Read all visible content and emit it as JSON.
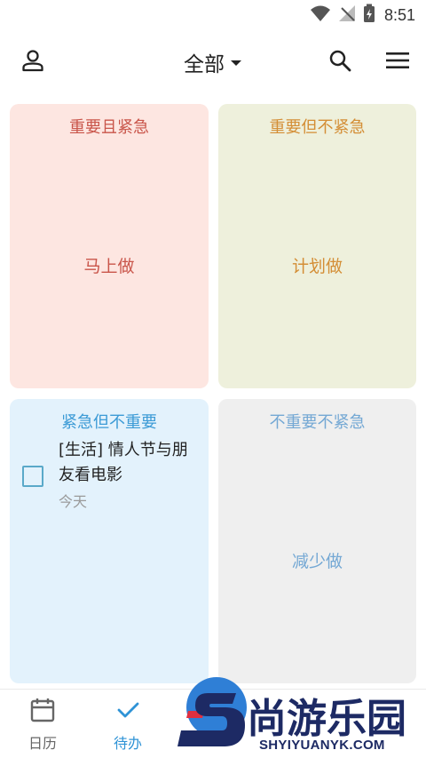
{
  "status_bar": {
    "time": "8:51",
    "icons": [
      "wifi-icon",
      "no-signal-icon",
      "battery-charging-icon"
    ]
  },
  "toolbar": {
    "filter_label": "全部",
    "icons": [
      "user-icon",
      "caret-down-icon",
      "search-icon",
      "menu-icon"
    ]
  },
  "quadrants": {
    "q1": {
      "title": "重要且紧急",
      "hint": "马上做",
      "color": "#c9554a",
      "background": "#fde6e1"
    },
    "q2": {
      "title": "重要但不紧急",
      "hint": "计划做",
      "color": "#d48e36",
      "background": "#eef0dc"
    },
    "q3": {
      "title": "紧急但不重要",
      "color": "#3c9bd6",
      "background": "#e3f2fc",
      "tasks": [
        {
          "title": "[生活] 情人节与朋友看电影",
          "date": "今天",
          "checked": false
        }
      ]
    },
    "q4": {
      "title": "不重要不紧急",
      "hint": "减少做",
      "color": "#74a8d4",
      "background": "#efefef"
    }
  },
  "bottom_nav": {
    "items": [
      {
        "label": "日历",
        "icon": "calendar-icon",
        "active": false
      },
      {
        "label": "待办",
        "icon": "check-icon",
        "active": true
      }
    ],
    "active_color": "#2f93d6"
  },
  "watermark": {
    "brand": "尚游乐园",
    "domain": "SHYIYUANYK.COM"
  }
}
